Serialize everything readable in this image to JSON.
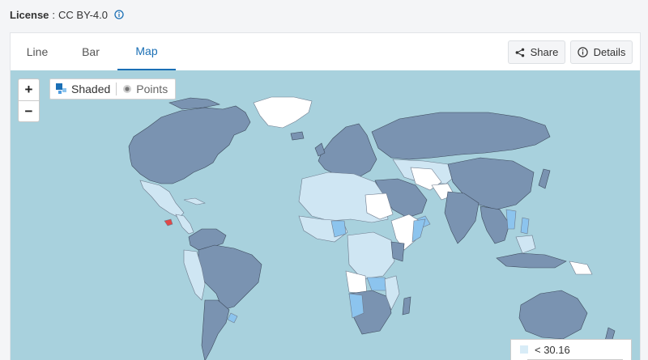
{
  "license": {
    "label": "License",
    "separator": ":",
    "value": "CC BY-4.0"
  },
  "tabs": [
    {
      "label": "Line",
      "active": false
    },
    {
      "label": "Bar",
      "active": false
    },
    {
      "label": "Map",
      "active": true
    }
  ],
  "actions": {
    "share_label": "Share",
    "details_label": "Details"
  },
  "map_controls": {
    "zoom_in": "+",
    "zoom_out": "−"
  },
  "display_modes": {
    "shaded": "Shaded",
    "points": "Points",
    "selected": "shaded"
  },
  "legend": {
    "first_bin_label": "< 30.16",
    "first_bin_color": "#d8ecf7"
  },
  "colors": {
    "accent": "#1a6fb5",
    "ocean": "#a8d1dd",
    "dark_shade": "#7a93b1",
    "light_shade": "#cfe6f3",
    "mid_shade": "#8cc4ee",
    "white_shade": "#ffffff",
    "highlight": "#e04848"
  }
}
